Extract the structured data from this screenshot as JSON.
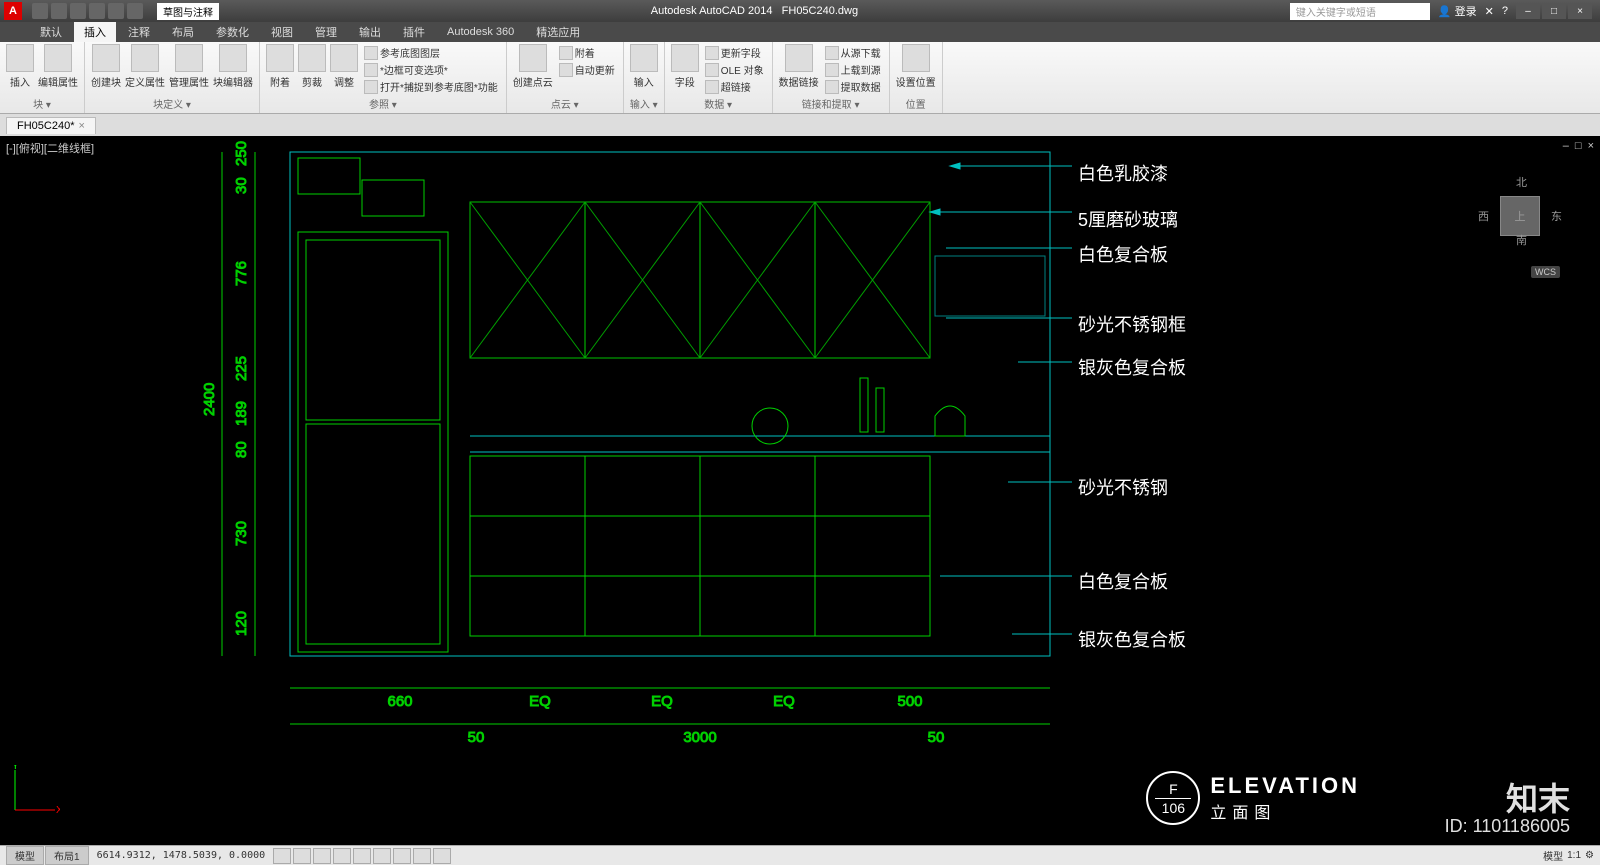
{
  "app": {
    "title": "Autodesk AutoCAD 2014",
    "file": "FH05C240.dwg",
    "logo": "A"
  },
  "qat": {
    "workspace": "草图与注释"
  },
  "search": {
    "placeholder": "键入关键字或短语"
  },
  "login": "登录",
  "winctrl": {
    "min": "–",
    "max": "□",
    "close": "×"
  },
  "tabs": [
    "默认",
    "插入",
    "注释",
    "布局",
    "参数化",
    "视图",
    "管理",
    "输出",
    "插件",
    "Autodesk 360",
    "精选应用"
  ],
  "ribbon": {
    "p1": {
      "name": "块 ▾",
      "b": [
        "插入",
        "编辑属性",
        "创建块",
        "定义属性",
        "管理属性",
        "块编辑器"
      ]
    },
    "p2": {
      "name": "块定义 ▾"
    },
    "p3": {
      "name": "参照 ▾",
      "b": [
        "附着",
        "剪裁",
        "调整"
      ],
      "s": [
        "参考底图图层",
        "*边框可变选项*",
        "打开*捕捉到参考底图*功能"
      ]
    },
    "p4": {
      "name": "点云 ▾",
      "b": [
        "创建点云"
      ],
      "s": [
        "附着",
        "自动更新"
      ]
    },
    "p5": {
      "name": "输入 ▾",
      "b": [
        "输入"
      ]
    },
    "p6": {
      "name": "数据 ▾",
      "b": [
        "字段"
      ],
      "s": [
        "更新字段",
        "OLE 对象",
        "超链接"
      ]
    },
    "p7": {
      "name": "链接和提取 ▾",
      "b": [
        "数据链接"
      ],
      "s": [
        "从源下载",
        "上载到源",
        "提取数据"
      ]
    },
    "p8": {
      "name": "位置",
      "b": [
        "设置位置"
      ]
    }
  },
  "filetab": {
    "name": "FH05C240*",
    "close": "×"
  },
  "view": {
    "label": "[-][俯视][二维线框]",
    "min": "–",
    "max": "□",
    "close": "×"
  },
  "viewcube": {
    "n": "北",
    "s": "南",
    "e": "东",
    "w": "西",
    "top": "上",
    "wcs": "WCS"
  },
  "dims": {
    "v": [
      "250",
      "30",
      "776",
      "225",
      "189",
      "80",
      "730",
      "120",
      "2400"
    ],
    "h": [
      "660",
      "EQ",
      "EQ",
      "EQ",
      "500",
      "50",
      "3000",
      "50"
    ]
  },
  "annot": [
    "白色乳胶漆",
    "5厘磨砂玻璃",
    "白色复合板",
    "砂光不锈钢框",
    "银灰色复合板",
    "砂光不锈钢",
    "白色复合板",
    "银灰色复合板"
  ],
  "elev": {
    "f": "F",
    "num": "106",
    "title": "ELEVATION",
    "sub": "立面图"
  },
  "watermark": {
    "brand": "知末",
    "id": "ID: 1101186005"
  },
  "status": {
    "tabs": [
      "模型",
      "布局1"
    ],
    "coords": "6614.9312, 1478.5039, 0.0000",
    "right": [
      "模型",
      "1:1"
    ]
  }
}
